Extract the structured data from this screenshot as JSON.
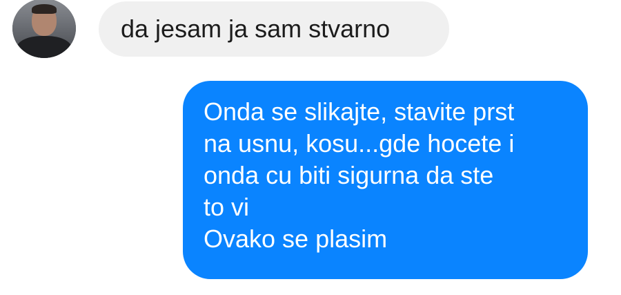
{
  "conversation": {
    "incoming": {
      "avatar_icon": "user-avatar-photo",
      "text": "da jesam ja sam stvarno"
    },
    "outgoing": {
      "bubble_color": "#0a84ff",
      "lines": [
        "Onda se slikajte, stavite prst",
        "na usnu, kosu...gde hocete i",
        "onda cu biti sigurna da ste",
        "to vi",
        "Ovako se plasim"
      ]
    }
  }
}
